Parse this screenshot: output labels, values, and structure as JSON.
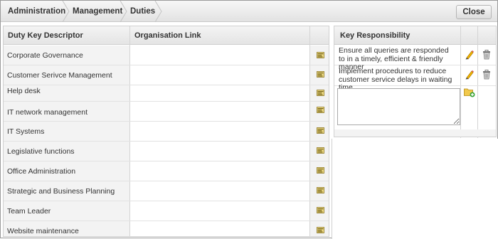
{
  "breadcrumb": [
    "Administration",
    "Management",
    "Duties"
  ],
  "close_label": "Close",
  "duties_table": {
    "columns": [
      "Duty Key Descriptor",
      "Organisation Link"
    ],
    "rows": [
      {
        "descriptor": "Corporate Governance",
        "organisation_link": ""
      },
      {
        "descriptor": "Customer Serivce Management",
        "organisation_link": ""
      },
      {
        "descriptor": "Help desk",
        "organisation_link": ""
      },
      {
        "descriptor": "IT network management",
        "organisation_link": ""
      },
      {
        "descriptor": "IT Systems",
        "organisation_link": ""
      },
      {
        "descriptor": "Legislative functions",
        "organisation_link": ""
      },
      {
        "descriptor": "Office Administration",
        "organisation_link": ""
      },
      {
        "descriptor": "Strategic and Business Planning",
        "organisation_link": ""
      },
      {
        "descriptor": "Team Leader",
        "organisation_link": ""
      },
      {
        "descriptor": "Website maintenance",
        "organisation_link": ""
      }
    ],
    "row_action_icon": "link-organisation-icon"
  },
  "responsibility_panel": {
    "header": "Key Responsibility",
    "items": [
      {
        "text": "Ensure all queries are responded to in a timely, efficient & friendly manner"
      },
      {
        "text": "Implement procedures to reduce customer service delays in waiting time"
      }
    ],
    "new_value": "",
    "icons": {
      "edit": "pencil-icon",
      "delete": "trash-icon",
      "add": "folder-add-icon"
    }
  }
}
